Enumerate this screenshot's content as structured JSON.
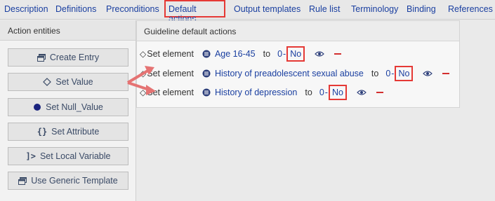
{
  "nav": {
    "tabs": [
      {
        "label": "Description"
      },
      {
        "label": "Definitions"
      },
      {
        "label": "Preconditions"
      },
      {
        "label": "Default actions"
      },
      {
        "label": "Output templates"
      },
      {
        "label": "Rule list"
      },
      {
        "label": "Terminology"
      },
      {
        "label": "Binding"
      },
      {
        "label": "References"
      }
    ],
    "active_index": 3
  },
  "left_panel": {
    "title": "Action entities",
    "buttons": [
      {
        "label": "Create Entry",
        "icon": "window-icon"
      },
      {
        "label": "Set Value",
        "icon": "diamond-icon"
      },
      {
        "label": "Set Null_Value",
        "icon": "filled-circle-icon"
      },
      {
        "label": "Set Attribute",
        "icon": "curly-braces-icon"
      },
      {
        "label": "Set Local Variable",
        "icon": "variable-arrow-icon"
      },
      {
        "label": "Use Generic Template",
        "icon": "window-icon"
      }
    ]
  },
  "right_panel": {
    "title": "Guideline default actions",
    "rows": [
      {
        "prefix": "Set element",
        "element": "Age 16-45",
        "to": "to",
        "code": "0",
        "value": "No"
      },
      {
        "prefix": "Set element",
        "element": "History of preadolescent sexual abuse",
        "to": "to",
        "code": "0",
        "value": "No"
      },
      {
        "prefix": "Set element",
        "element": "History of depression",
        "to": "to",
        "code": "0",
        "value": "No"
      }
    ]
  },
  "colors": {
    "highlight": "#e53935",
    "link": "#1a3fa0",
    "arrow": "#e57373"
  }
}
